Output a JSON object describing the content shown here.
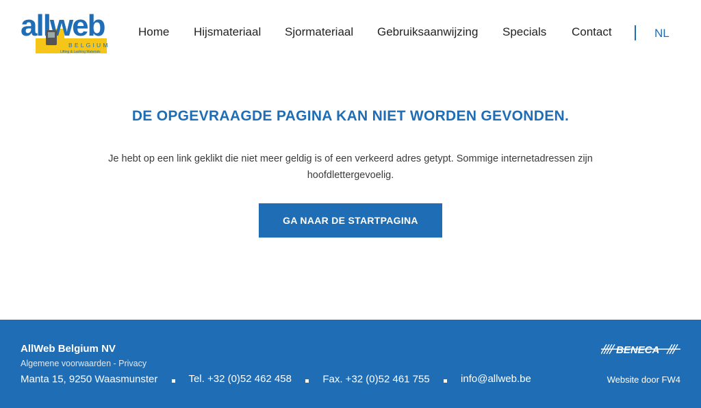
{
  "header": {
    "logo": {
      "brand": "allweb",
      "sub": "BELGIUM",
      "tagline": "Lifting & Lashing Materials",
      "colors": {
        "blue": "#1f6db4",
        "yellow": "#f5c518"
      }
    },
    "nav": [
      {
        "label": "Home"
      },
      {
        "label": "Hijsmateriaal"
      },
      {
        "label": "Sjormateriaal"
      },
      {
        "label": "Gebruiksaanwijzing"
      },
      {
        "label": "Specials"
      },
      {
        "label": "Contact"
      }
    ],
    "language": "NL"
  },
  "main": {
    "title": "DE OPGEVRAAGDE PAGINA KAN NIET WORDEN GEVONDEN.",
    "message": "Je hebt op een link geklikt die niet meer geldig is of een verkeerd adres getypt. Sommige internetadressen zijn hoofdlettergevoelig.",
    "button": "GA NAAR DE STARTPAGINA"
  },
  "footer": {
    "company": "AllWeb Belgium NV",
    "terms": "Algemene voorwaarden",
    "legal_sep": " - ",
    "privacy": "Privacy",
    "address": "Manta 15, 9250 Waasmunster",
    "phone": "Tel. +32 (0)52 462 458",
    "fax": "Fax. +32 (0)52 461 755",
    "email": "info@allweb.be",
    "partner_logo": "BENECA",
    "credit": "Website door FW4"
  },
  "colors": {
    "accent": "#1f6db4",
    "footer_bg": "#1f6db4",
    "text": "#2b2b2b"
  }
}
